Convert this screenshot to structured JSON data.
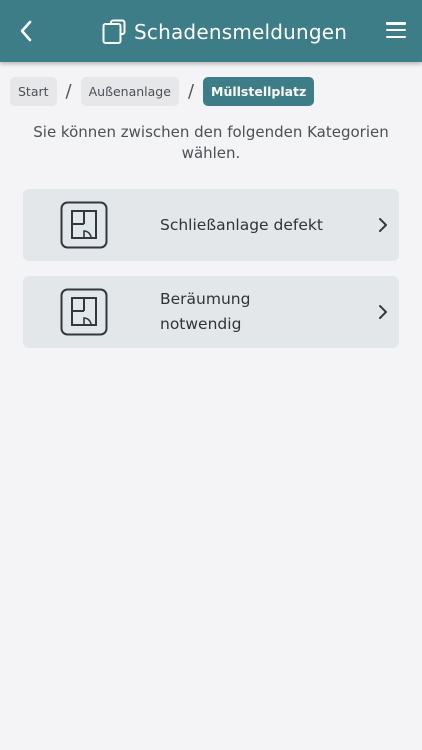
{
  "header": {
    "title": "Schadensmeldungen",
    "back_icon": "chevron-left-icon",
    "title_icon": "document-icon",
    "menu_icon": "hamburger-menu-icon",
    "color": "#3d7d87"
  },
  "breadcrumb": {
    "items": [
      {
        "label": "Start",
        "active": false
      },
      {
        "label": "Außenanlage",
        "active": false
      },
      {
        "label": "Müllstellplatz",
        "active": true
      }
    ],
    "separator": "/"
  },
  "intro_text": "Sie können zwischen den folgenden Kategorien wählen.",
  "categories": [
    {
      "label": "Schließanlage defekt",
      "icon": "floorplan-icon",
      "chevron": "chevron-right-icon"
    },
    {
      "label": "Beräumung notwendig",
      "icon": "floorplan-icon",
      "chevron": "chevron-right-icon"
    }
  ]
}
